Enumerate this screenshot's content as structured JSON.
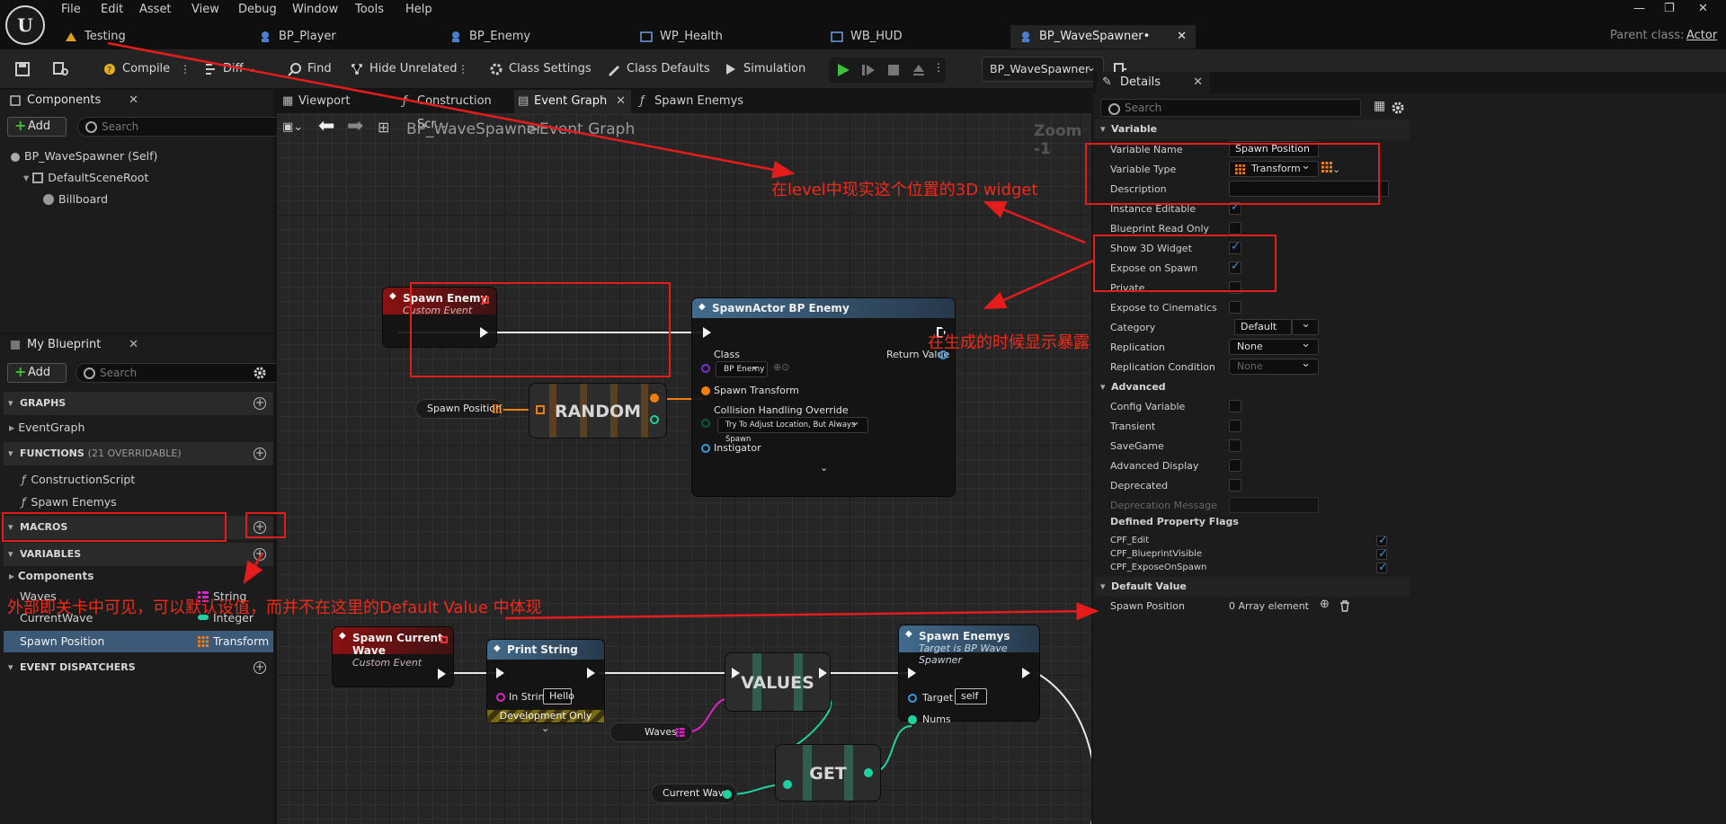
{
  "menu": {
    "items": [
      "File",
      "Edit",
      "Asset",
      "View",
      "Debug",
      "Window",
      "Tools",
      "Help"
    ]
  },
  "tabs": [
    {
      "label": "Testing"
    },
    {
      "label": "BP_Player"
    },
    {
      "label": "BP_Enemy"
    },
    {
      "label": "WP_Health"
    },
    {
      "label": "WB_HUD"
    },
    {
      "label": "BP_WaveSpawner•"
    }
  ],
  "parent_class": {
    "label": "Parent class:",
    "value": "Actor"
  },
  "toolbar": {
    "compile": "Compile",
    "diff": "Diff",
    "find": "Find",
    "hide_unrelated": "Hide Unrelated",
    "class_settings": "Class Settings",
    "class_defaults": "Class Defaults",
    "simulation": "Simulation",
    "debug_object": "BP_WaveSpawner"
  },
  "components_panel": {
    "tab": "Components",
    "add": "Add",
    "search_placeholder": "Search",
    "items": [
      "BP_WaveSpawner (Self)",
      "DefaultSceneRoot",
      "Billboard"
    ]
  },
  "my_blueprint": {
    "tab": "My Blueprint",
    "add": "Add",
    "search_placeholder": "Search",
    "graphs_header": "GRAPHS",
    "event_graph": "EventGraph",
    "functions_header": "FUNCTIONS",
    "functions_hint": "(21 OVERRIDABLE)",
    "functions": [
      "ConstructionScript",
      "Spawn Enemys"
    ],
    "macros_header": "MACROS",
    "variables_header": "VARIABLES",
    "components_group": "Components",
    "variables": [
      {
        "name": "Waves",
        "type": "String"
      },
      {
        "name": "CurrentWave",
        "type": "Integer"
      },
      {
        "name": "Spawn Position",
        "type": "Transform"
      }
    ],
    "dispatchers_header": "EVENT DISPATCHERS"
  },
  "graph": {
    "tabs": [
      "Viewport",
      "Construction Scr...",
      "Event Graph",
      "Spawn Enemys"
    ],
    "breadcrumb_root": "BP_WaveSpawner",
    "breadcrumb_sep": ">",
    "breadcrumb_leaf": "Event Graph",
    "zoom": "Zoom -1",
    "nodes": {
      "spawn_enemy": {
        "title": "Spawn Enemy",
        "subtitle": "Custom Event"
      },
      "spawn_actor": {
        "title": "SpawnActor BP Enemy",
        "class_label": "Class",
        "class_value": "BP Enemy",
        "return_value": "Return Value",
        "spawn_transform": "Spawn Transform",
        "collision": "Collision Handling Override",
        "collision_value": "Try To Adjust Location, But Always Spawn",
        "instigator": "Instigator"
      },
      "spawn_position_get": "Spawn Position",
      "random": "RANDOM",
      "spawn_current_wave": {
        "title": "Spawn Current Wave",
        "subtitle": "Custom Event"
      },
      "print_string": {
        "title": "Print String",
        "in_string": "In String",
        "in_string_value": "Hello",
        "dev_only": "Development Only"
      },
      "values": "VALUES",
      "waves_get": "Waves",
      "spawn_enemys": {
        "title": "Spawn Enemys",
        "subtitle": "Target is BP Wave Spawner",
        "target": "Target",
        "target_value": "self",
        "nums": "Nums"
      },
      "get": "GET",
      "current_wave_get": "Current Wave"
    }
  },
  "details": {
    "tab": "Details",
    "search_placeholder": "Search",
    "variable_header": "Variable",
    "variable_name_label": "Variable Name",
    "variable_name": "Spawn Position",
    "variable_type_label": "Variable Type",
    "variable_type": "Transform",
    "description_label": "Description",
    "instance_editable": "Instance Editable",
    "blueprint_read_only": "Blueprint Read Only",
    "show_3d_widget": "Show 3D Widget",
    "expose_on_spawn": "Expose on Spawn",
    "private": "Private",
    "expose_to_cinematics": "Expose to Cinematics",
    "category_label": "Category",
    "category": "Default",
    "replication_label": "Replication",
    "replication": "None",
    "replication_condition_label": "Replication Condition",
    "replication_condition": "None",
    "advanced_header": "Advanced",
    "config_variable": "Config Variable",
    "transient": "Transient",
    "savegame": "SaveGame",
    "advanced_display": "Advanced Display",
    "deprecated": "Deprecated",
    "deprecation_message": "Deprecation Message",
    "flags_header": "Defined Property Flags",
    "flags": [
      "CPF_Edit",
      "CPF_BlueprintVisible",
      "CPF_ExposeOnSpawn"
    ],
    "default_value_header": "Default Value",
    "default_spawn_position": "Spawn Position",
    "default_array": "0 Array element"
  },
  "annotations": {
    "widget_note": "在level中现实这个位置的3D widget",
    "spawn_note": "在生成的时候显示暴露",
    "default_note": "外部即关卡中可见，可以默认设值，而并不在这里的Default Value 中体现"
  },
  "colors": {
    "annotation": "#e51c1c",
    "transform_pin": "#f07d10",
    "string_pin": "#e020c8",
    "integer_pin": "#1fd2a2",
    "object_pin": "#3a9ad9",
    "accent": "#3d8ee6"
  },
  "icons": [
    "unreal-logo-icon",
    "save-icon",
    "browse-icon",
    "compile-icon",
    "diff-icon",
    "find-icon",
    "hide-unrelated-icon",
    "class-settings-icon",
    "class-defaults-icon",
    "simulation-icon",
    "play-icon",
    "step-icon",
    "stop-icon",
    "eject-icon",
    "eye-icon",
    "gear-icon",
    "search-icon",
    "trash-icon"
  ]
}
